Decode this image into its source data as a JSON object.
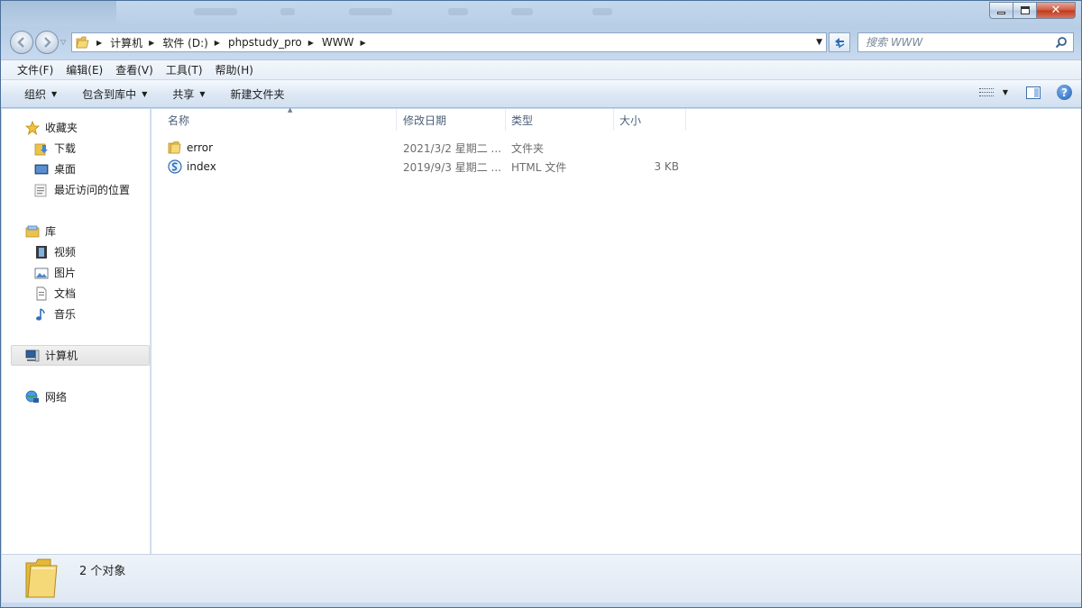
{
  "window": {
    "controls": {
      "minimize": "minimize",
      "maximize": "maximize",
      "close": "✕"
    }
  },
  "address": {
    "crumbs": [
      "计算机",
      "软件 (D:)",
      "phpstudy_pro",
      "WWW"
    ]
  },
  "search": {
    "placeholder": "搜索 WWW"
  },
  "menu": [
    "文件(F)",
    "编辑(E)",
    "查看(V)",
    "工具(T)",
    "帮助(H)"
  ],
  "commands": {
    "organize": "组织",
    "include_library": "包含到库中",
    "share": "共享",
    "new_folder": "新建文件夹"
  },
  "nav": {
    "favorites": {
      "label": "收藏夹",
      "items": [
        "下载",
        "桌面",
        "最近访问的位置"
      ]
    },
    "libraries": {
      "label": "库",
      "items": [
        "视频",
        "图片",
        "文档",
        "音乐"
      ]
    },
    "computer": "计算机",
    "network": "网络"
  },
  "columns": {
    "name": "名称",
    "date": "修改日期",
    "type": "类型",
    "size": "大小"
  },
  "files": [
    {
      "name": "error",
      "date": "2021/3/2 星期二 ...",
      "type": "文件夹",
      "size": "",
      "icon": "folder-icon"
    },
    {
      "name": "index",
      "date": "2019/9/3 星期二 ...",
      "type": "HTML 文件",
      "size": "3 KB",
      "icon": "html-file-icon"
    }
  ],
  "status": {
    "count": "2 个对象"
  },
  "colors": {
    "accent": "#2d6db5",
    "folder": "#e9c34f",
    "window_frame": "#b7cde5"
  }
}
